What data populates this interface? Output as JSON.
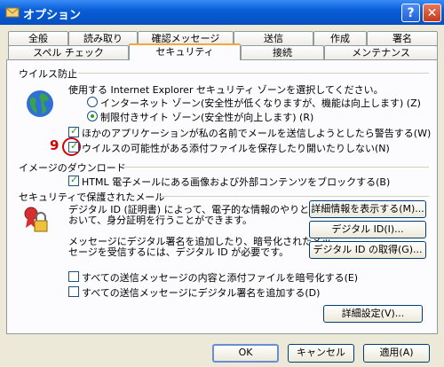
{
  "window": {
    "title": "オプション"
  },
  "tabs_back": [
    "全般",
    "読み取り",
    "確認メッセージ",
    "送信",
    "作成",
    "署名"
  ],
  "tabs_front": [
    "スペル チェック",
    "セキュリティ",
    "接続",
    "メンテナンス"
  ],
  "active_tab": "セキュリティ",
  "virus": {
    "heading": "ウイルス防止",
    "zone_text": "使用する Internet Explorer セキュリティ ゾーンを選択してください。",
    "radio_internet": "インターネット ゾーン(安全性が低くなりますが、機能は向上します) (Z)",
    "radio_restricted": "制限付きサイト ゾーン(安全性が向上します) (R)",
    "warn_apps": "ほかのアプリケーションが私の名前でメールを送信しようとしたら警告する(W)",
    "block_attach": "ウイルスの可能性がある添付ファイルを保存したり開いたりしない(N)"
  },
  "annotation": {
    "number": "9"
  },
  "images": {
    "heading": "イメージのダウンロード",
    "block_images": "HTML 電子メールにある画像および外部コンテンツをブロックする(B)"
  },
  "secure_mail": {
    "heading": "セキュリティで保護されたメール",
    "desc1_line1": "デジタル ID (証明書) によって、電子的な情報のやりとりに",
    "desc1_line2": "おいて、身分証明を行うことができます。",
    "desc2_line1": "メッセージにデジタル署名を追加したり、暗号化されたメッ",
    "desc2_line2": "セージを受信するには、デジタル ID が必要です。",
    "btn_details": "詳細情報を表示する(M)...",
    "btn_digital_id": "デジタル ID(I)...",
    "btn_get_id": "デジタル ID の取得(G)...",
    "encrypt_all": "すべての送信メッセージの内容と添付ファイルを暗号化する(E)",
    "sign_all": "すべての送信メッセージにデジタル署名を追加する(D)",
    "btn_advanced": "詳細設定(V)..."
  },
  "footer": {
    "ok": "OK",
    "cancel": "キャンセル",
    "apply": "適用(A)"
  },
  "colors": {
    "title_blue": "#0553c8",
    "annotation_red": "#d40000",
    "check_green": "#21a121"
  }
}
